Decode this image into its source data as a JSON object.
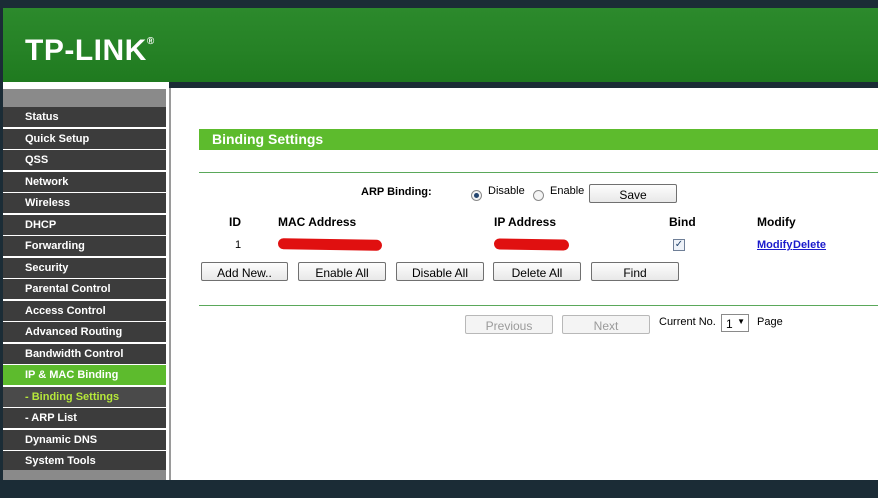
{
  "brand": {
    "logo_text": "TP-LINK",
    "registered_mark": "®",
    "accent_green": "#5dbb2d",
    "header_green": "#268226"
  },
  "sidebar": {
    "items": [
      {
        "label": "Status",
        "state": "normal"
      },
      {
        "label": "Quick Setup",
        "state": "normal"
      },
      {
        "label": "QSS",
        "state": "normal"
      },
      {
        "label": "Network",
        "state": "normal"
      },
      {
        "label": "Wireless",
        "state": "normal"
      },
      {
        "label": "DHCP",
        "state": "normal"
      },
      {
        "label": "Forwarding",
        "state": "normal"
      },
      {
        "label": "Security",
        "state": "normal"
      },
      {
        "label": "Parental Control",
        "state": "normal"
      },
      {
        "label": "Access Control",
        "state": "normal"
      },
      {
        "label": "Advanced Routing",
        "state": "normal"
      },
      {
        "label": "Bandwidth Control",
        "state": "normal"
      },
      {
        "label": "IP & MAC Binding",
        "state": "active"
      },
      {
        "label": "- Binding Settings",
        "state": "sub-active"
      },
      {
        "label": "- ARP List",
        "state": "normal"
      },
      {
        "label": "Dynamic DNS",
        "state": "normal"
      },
      {
        "label": "System Tools",
        "state": "normal"
      }
    ]
  },
  "main": {
    "title": "Binding Settings",
    "arp": {
      "label": "ARP Binding:",
      "options": [
        "Disable",
        "Enable"
      ],
      "selected": "Disable",
      "save_label": "Save"
    },
    "table": {
      "headers": [
        "ID",
        "MAC Address",
        "IP Address",
        "Bind",
        "Modify"
      ],
      "rows": [
        {
          "id": "1",
          "mac": "[redacted]",
          "ip": "[redacted]",
          "bind": true,
          "modify": "Modify",
          "delete": "Delete"
        }
      ]
    },
    "actions": [
      "Add New..",
      "Enable All",
      "Disable All",
      "Delete All",
      "Find"
    ],
    "pager": {
      "previous": "Previous",
      "next": "Next",
      "current_label": "Current No.",
      "current_value": "1",
      "page_label": "Page"
    }
  }
}
